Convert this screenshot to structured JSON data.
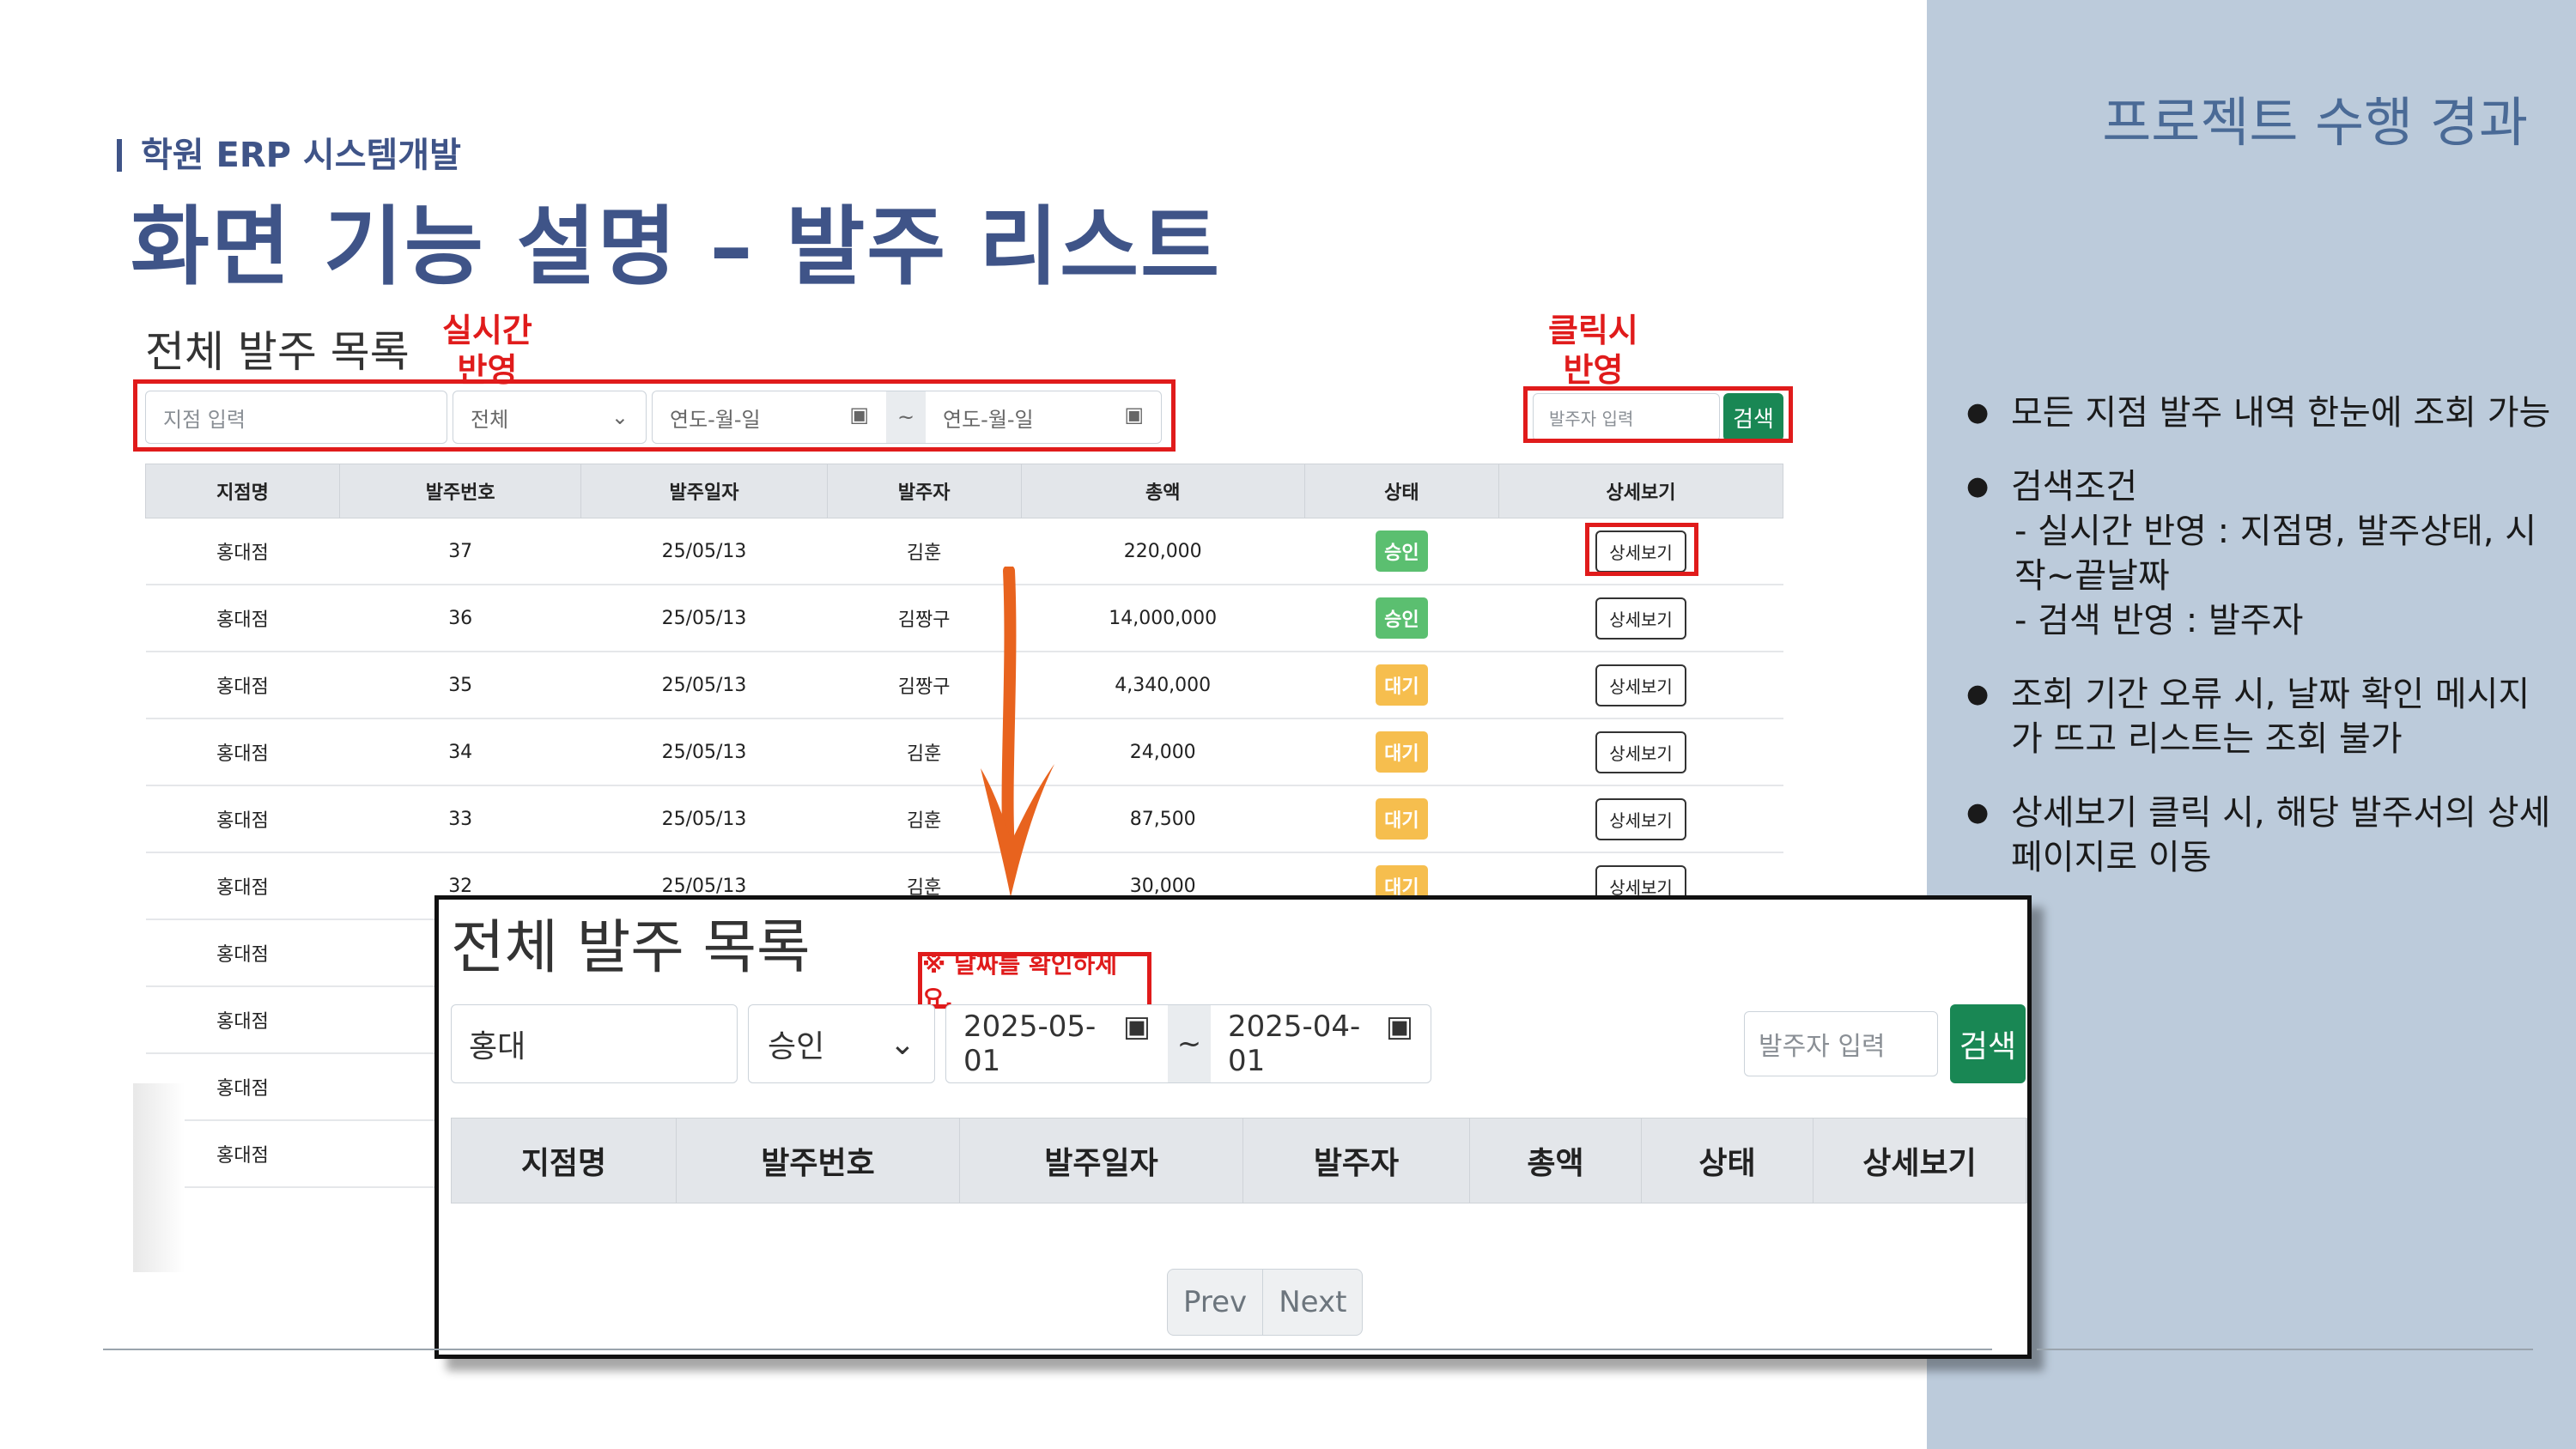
{
  "slide": {
    "breadcrumb": "학원 ERP 시스템개발",
    "title": "화면 기능 설명 – 발주 리스트",
    "panel_title": "프로젝트 수행 경과",
    "bullets": [
      {
        "text": "모든 지점 발주 내역 한눈에 조회 가능"
      },
      {
        "text": "검색조건",
        "sub1": "- 실시간 반영 : 지점명, 발주상태, 시작~끝날짜",
        "sub2": "- 검색 반영 : 발주자"
      },
      {
        "text": "조회 기간 오류 시, 날짜 확인 메시지가 뜨고 리스트는 조회 불가"
      },
      {
        "text": "상세보기 클릭 시, 해당 발주서의 상세 페이지로 이동"
      }
    ],
    "annotations": {
      "realtime": "실시간\n반영",
      "click": "클릭시\n반영",
      "date_error": "※ 날짜를 확인하세요."
    },
    "colors": {
      "title": "#3f5488",
      "panel": "#bccbdb",
      "annotation_red": "#e01b1b",
      "arrow": "#e8631e",
      "search_green": "#198754"
    }
  },
  "list1": {
    "title": "전체 발주 목록",
    "branch_placeholder": "지점 입력",
    "status_value": "전체",
    "date_start_placeholder": "연도-월-일",
    "date_separator": "~",
    "date_end_placeholder": "연도-월-일",
    "orderer_placeholder": "발주자 입력",
    "search_label": "검색",
    "columns": [
      "지점명",
      "발주번호",
      "발주일자",
      "발주자",
      "총액",
      "상태",
      "상세보기"
    ],
    "rows": [
      {
        "branch": "홍대점",
        "no": "37",
        "date": "25/05/13",
        "orderer": "김훈",
        "total": "220,000",
        "status": "승인",
        "detail": "상세보기"
      },
      {
        "branch": "홍대점",
        "no": "36",
        "date": "25/05/13",
        "orderer": "김짱구",
        "total": "14,000,000",
        "status": "승인",
        "detail": "상세보기"
      },
      {
        "branch": "홍대점",
        "no": "35",
        "date": "25/05/13",
        "orderer": "김짱구",
        "total": "4,340,000",
        "status": "대기",
        "detail": "상세보기"
      },
      {
        "branch": "홍대점",
        "no": "34",
        "date": "25/05/13",
        "orderer": "김훈",
        "total": "24,000",
        "status": "대기",
        "detail": "상세보기"
      },
      {
        "branch": "홍대점",
        "no": "33",
        "date": "25/05/13",
        "orderer": "김훈",
        "total": "87,500",
        "status": "대기",
        "detail": "상세보기"
      },
      {
        "branch": "홍대점",
        "no": "32",
        "date": "25/05/13",
        "orderer": "김훈",
        "total": "30,000",
        "status": "대기",
        "detail": "상세보기"
      },
      {
        "branch": "홍대점"
      },
      {
        "branch": "홍대점"
      },
      {
        "branch": "홍대점"
      },
      {
        "branch": "홍대점"
      }
    ]
  },
  "list2": {
    "title": "전체 발주 목록",
    "branch_value": "홍대",
    "status_value": "승인",
    "date_start_value": "2025-05-01",
    "date_separator": "~",
    "date_end_value": "2025-04-01",
    "orderer_placeholder": "발주자 입력",
    "search_label": "검색",
    "columns": [
      "지점명",
      "발주번호",
      "발주일자",
      "발주자",
      "총액",
      "상태",
      "상세보기"
    ],
    "prev_label": "Prev",
    "next_label": "Next"
  }
}
